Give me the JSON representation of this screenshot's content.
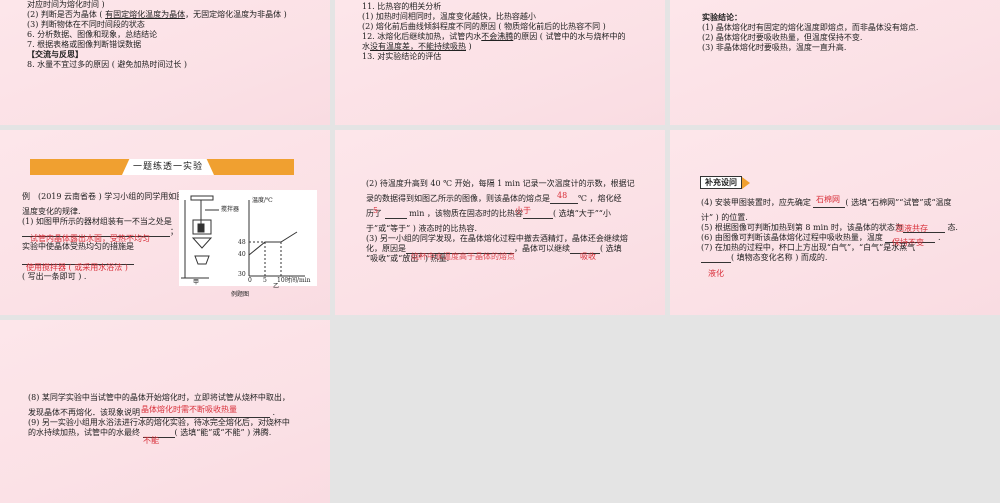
{
  "slide1": {
    "lines": [
      "对应时间为熔化时间 )",
      "(2) 判断是否为晶体 ( ",
      "有固定熔化温度为晶体",
      "，无固定熔化温度为非晶体 )",
      "(3) 判断物体在不同时间段的状态",
      "6. 分析数据、图像和现象，总结结论",
      "7. 根据表格或图像判断错误数据",
      "【交流与反思】",
      "8. 水量不宜过多的原因 ( 避免加热时间过长 )"
    ]
  },
  "slide2": {
    "lines": [
      "11. 比热容的相关分析",
      "(1) 加热时间相同时，温度变化越快，比热容越小",
      "(2) 熔化前后曲线倾斜程度不同的原因 ( 物质熔化前后的比热容不同 )",
      "12. 冰熔化后继续加热，试管内水",
      "不会沸腾",
      "的原因 ( 试管中的水与烧杯中的",
      "水",
      "没有温度差，不能持续吸热",
      " )",
      "13. 对实验结论的评估"
    ]
  },
  "slide3": {
    "title": "实验结论：",
    "lines": [
      "(1) 晶体熔化时有固定的熔化温度即熔点，而非晶体没有熔点.",
      "(2) 晶体熔化时要吸收热量，但温度保持不变.",
      "(3) 非晶体熔化时要吸热，温度一直升高."
    ]
  },
  "slide4": {
    "banner": "一题练透一实验",
    "q": "例　(2019 云南省卷 ) 学习小组的同学用如图甲所示的装置探究某种晶体熔化时",
    "q2": "温度变化的规律.",
    "p1": "(1) 如图甲所示的器材组装有一不当之处是",
    "a1": "试管内晶体露出水面，受热不均匀",
    "p2": "实验中使晶体受热均匀的措施是",
    "a2": "使用搅拌器 ( 或采用水浴法 )",
    "p3": "( 写出一条即可 ) .",
    "fig": {
      "stirrer": "搅拌器",
      "ylabel": "温度/℃",
      "xlabel": "时间/min",
      "yticks": [
        "48",
        "40",
        "30"
      ],
      "xticks": [
        "0",
        "5",
        "10"
      ],
      "jia": "甲",
      "yi": "乙",
      "caption": "例题图"
    }
  },
  "slide5": {
    "l1": "(2) 待温度升高到 40 ℃ 开始，每隔 1 min 记录一次温度计的示数，根据记",
    "l2a": "录的数据得到如图乙所示的图像，则该晶体的熔点是",
    "a1": "48",
    "l2b": "℃ ，熔化经",
    "l3a": "历了",
    "a2": "5",
    "l3b": "min ，该物质在固态时的比热容",
    "a3": "小于",
    "l3c": "( 选填“大于”“小",
    "l4": "于”或“等于” ) 液态时的比热容.",
    "l5": "(3) 另一小组的同学发现，在晶体熔化过程中撤去酒精灯，晶体还会继续熔",
    "l6a": "化，原因是",
    "l6b": "，晶体可以继续",
    "l6c": "( 选填",
    "l7": "“吸收”或“放出” ) 热量.",
    "a4": "烧杯中水温度高于晶体的熔点",
    "a5": "吸收"
  },
  "slide6": {
    "tag": "补充设问",
    "l1a": "(4) 安装甲图装置时，应先确定",
    "a1": "石棉网",
    "l1b": "( 选填“石棉网”“试管”或“温度",
    "l2": "计” ) 的位置.",
    "l3a": "(5) 根据图像可判断加热到第 8 min 时，该晶体的状态为",
    "a2": "固液共存",
    "l3b": "态.",
    "l4": "(6) 由图像可判断该晶体熔化过程中吸收热量，温度",
    "a3": "保持不变",
    "l5": "(7) 在加热的过程中，杯口上方出现“白气”，“白气”是水蒸气",
    "l6": "( 填物态变化名称 ) 而成的.",
    "a4": "液化"
  },
  "slide7": {
    "l1": "(8) 某同学实验中当试管中的晶体开始熔化时，立即将试管从烧杯中取出，",
    "l2": "发现晶体不再熔化．该现象说明",
    "a1": "晶体熔化时需不断吸收热量",
    "l3": "(9) 另一实验小组用水浴法进行冰的熔化实验，待冰完全熔化后，对烧杯中",
    "l4a": "的水持续加热，试管中的水最终",
    "l4b": "( 选填“能”或“不能” ) 沸腾.",
    "a2": "不能"
  },
  "colors": {
    "answer": "#d9303a",
    "banner": "#f0a030",
    "background": "#e4e4e4"
  }
}
